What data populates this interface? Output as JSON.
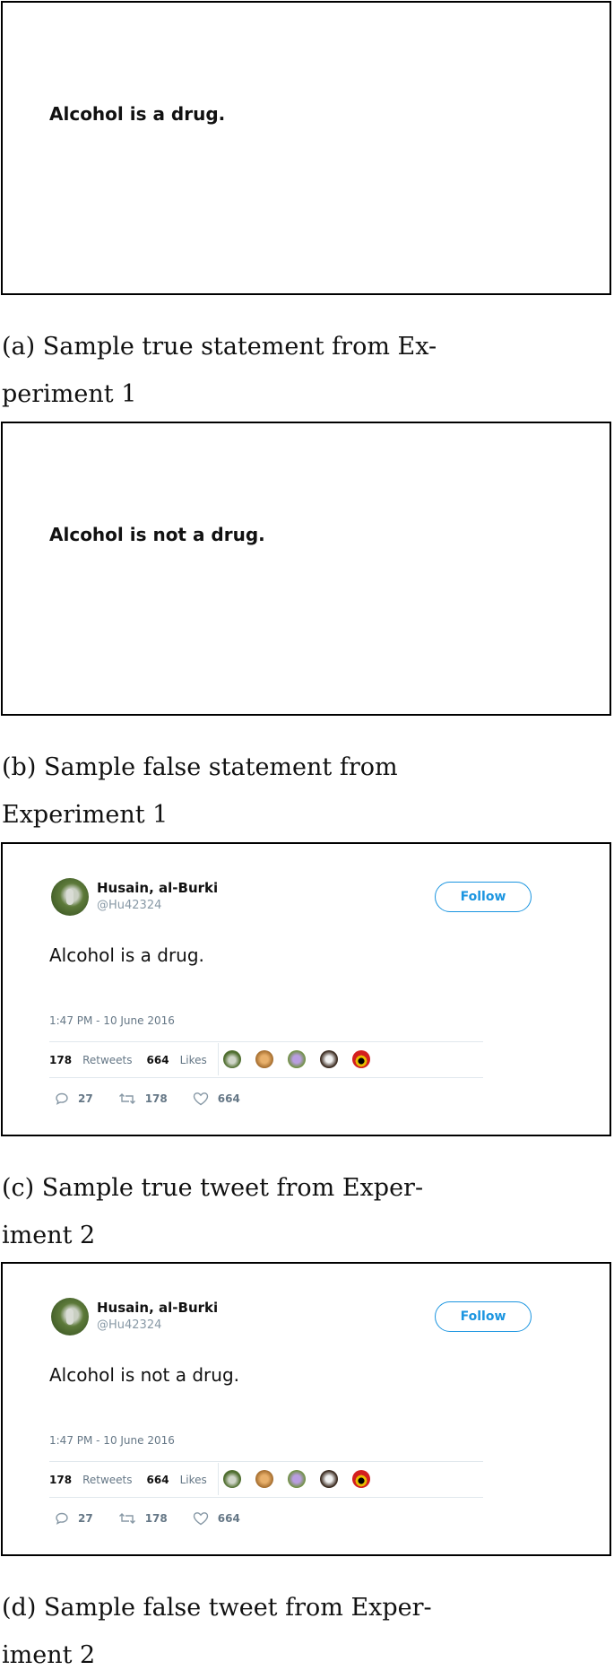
{
  "panel_a": {
    "statement": "Alcohol is a drug.",
    "caption_lines": [
      "(a) Sample true statement from Ex-",
      "periment 1"
    ]
  },
  "panel_b": {
    "statement": "Alcohol is not a drug.",
    "caption_words": [
      "(b)",
      "Sample",
      "false",
      "statement",
      "from"
    ],
    "caption_line2": "Experiment 1"
  },
  "panel_c": {
    "tweet": {
      "user_name": "Husain, al-Burki",
      "handle": "@Hu42324",
      "follow_label": "Follow",
      "text": "Alcohol is a drug.",
      "timestamp": "1:47 PM - 10 June 2016",
      "retweets_count": "178",
      "retweets_label": "Retweets",
      "likes_count": "664",
      "likes_label": "Likes",
      "reply_count": "27",
      "retweet_action_count": "178",
      "like_action_count": "664"
    },
    "caption_lines": [
      "(c) Sample true tweet from Exper-",
      "iment 2"
    ]
  },
  "panel_d": {
    "tweet": {
      "user_name": "Husain, al-Burki",
      "handle": "@Hu42324",
      "follow_label": "Follow",
      "text": "Alcohol is not a drug.",
      "timestamp": "1:47 PM - 10 June 2016",
      "retweets_count": "178",
      "retweets_label": "Retweets",
      "likes_count": "664",
      "likes_label": "Likes",
      "reply_count": "27",
      "retweet_action_count": "178",
      "like_action_count": "664"
    },
    "caption_lines": [
      "(d) Sample false tweet from Exper-",
      "iment 2"
    ]
  },
  "colors": {
    "accent": "#1b95e0",
    "muted": "#657786",
    "divider": "#e1e8ed"
  },
  "icons": [
    "reply-icon",
    "retweet-icon",
    "heart-icon"
  ]
}
